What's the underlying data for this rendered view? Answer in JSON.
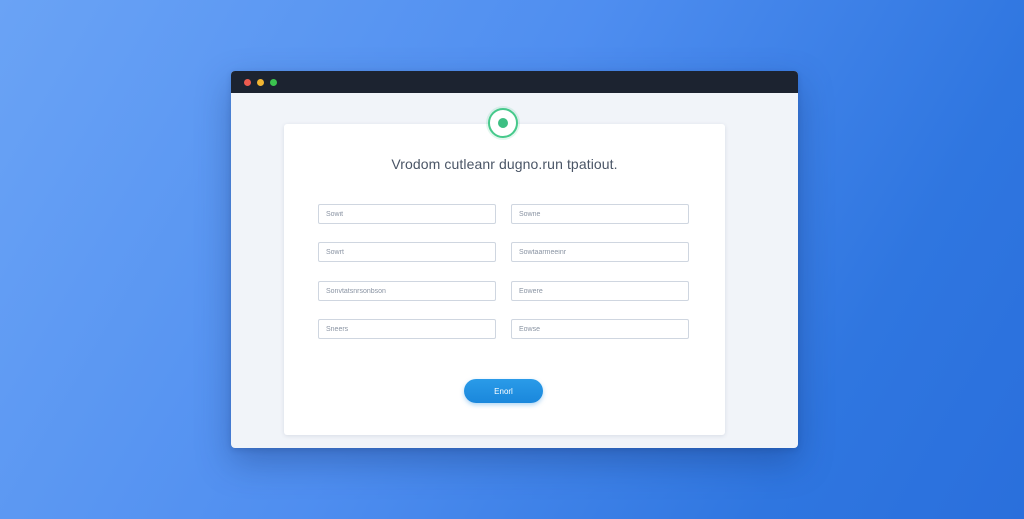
{
  "window": {
    "controls": [
      "close",
      "minimize",
      "maximize"
    ]
  },
  "form": {
    "logo_icon": "circle-logo-icon",
    "title": "Vrodom cutleanr dugno.run tpatiout.",
    "fields": [
      {
        "placeholder": "Sowit"
      },
      {
        "placeholder": "Sowne"
      },
      {
        "placeholder": "Sowrt"
      },
      {
        "placeholder": "Sowtaarmeeinr"
      },
      {
        "placeholder": "Sonvtatsnrsonbson"
      },
      {
        "placeholder": "Eowere"
      },
      {
        "placeholder": "Sneers"
      },
      {
        "placeholder": "Eowse"
      }
    ],
    "submit_label": "Enorl"
  },
  "colors": {
    "background_start": "#6aa3f5",
    "background_end": "#2a6fdc",
    "titlebar": "#1c2330",
    "accent_green": "#46c98b",
    "submit_blue": "#1a87dc"
  }
}
